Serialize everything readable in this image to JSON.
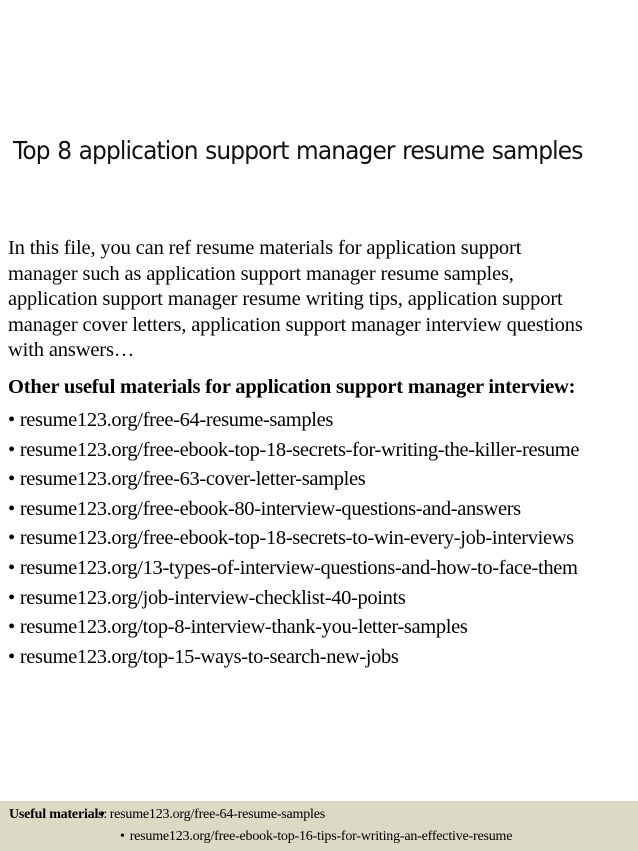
{
  "title": "Top 8 application support manager resume samples",
  "intro_lines": [
    "In this file, you can ref resume materials for application support",
    "manager such as  application support manager resume samples,",
    "application support manager resume writing tips, application support",
    "manager cover letters, application support manager interview questions",
    "with answers…"
  ],
  "materials": {
    "heading": "Other useful materials for application support manager interview:",
    "bullet": "•",
    "links": [
      "resume123.org/free-64-resume-samples",
      "resume123.org/free-ebook-top-18-secrets-for-writing-the-killer-resume",
      "resume123.org/free-63-cover-letter-samples",
      "resume123.org/free-ebook-80-interview-questions-and-answers",
      "resume123.org/free-ebook-top-18-secrets-to-win-every-job-interviews",
      "resume123.org/13-types-of-interview-questions-and-how-to-face-them",
      "resume123.org/job-interview-checklist-40-points",
      "resume123.org/top-8-interview-thank-you-letter-samples",
      "resume123.org/top-15-ways-to-search-new-jobs"
    ]
  },
  "footer": {
    "label": "Useful materials",
    "colon": ":",
    "bullet": "•",
    "links": [
      "resume123.org/free-64-resume-samples",
      "resume123.org/free-ebook-top-16-tips-for-writing-an-effective-resume"
    ],
    "background_color": "#dcd9c5"
  }
}
